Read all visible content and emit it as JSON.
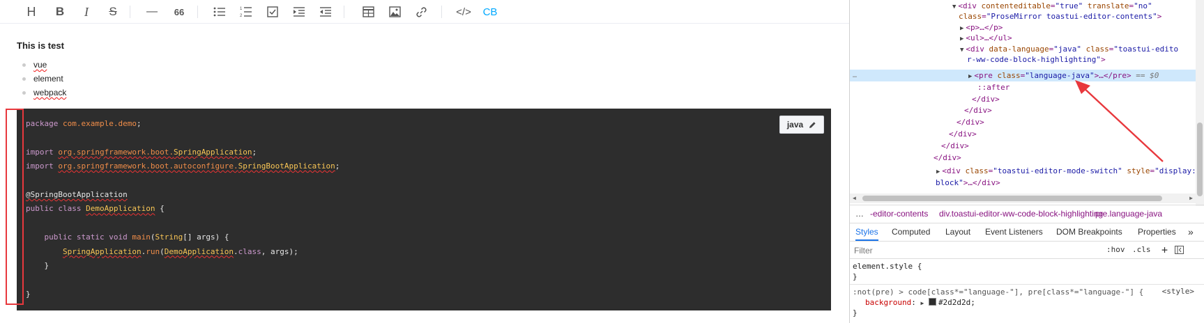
{
  "toolbar": {
    "buttons": [
      {
        "name": "heading",
        "glyph": "H"
      },
      {
        "name": "bold",
        "glyph": "B"
      },
      {
        "name": "italic",
        "glyph": "I"
      },
      {
        "name": "strike",
        "glyph": "S"
      },
      {
        "name": "hr",
        "glyph": "—"
      },
      {
        "name": "quote",
        "glyph": "66"
      },
      {
        "name": "ul"
      },
      {
        "name": "ol"
      },
      {
        "name": "task"
      },
      {
        "name": "indent"
      },
      {
        "name": "outdent"
      },
      {
        "name": "table"
      },
      {
        "name": "image"
      },
      {
        "name": "link"
      },
      {
        "name": "code",
        "glyph": "</>"
      },
      {
        "name": "codeblock",
        "glyph": "CB"
      }
    ],
    "accent_color": "#00a9ff"
  },
  "editor": {
    "heading": "This is test",
    "list": [
      "vue",
      "element",
      "webpack"
    ],
    "code_block": {
      "language_button": "java",
      "lines": {
        "l1_kw": "package",
        "l1_pkg": "com.example.demo",
        "l1_end": ";",
        "l3_kw": "import",
        "l3_pkg": "org.springframework.boot.",
        "l3_cls": "SpringApplication",
        "l3_end": ";",
        "l4_kw": "import",
        "l4_pkg": "org.springframework.boot.autoconfigure.",
        "l4_cls": "SpringBootApplication",
        "l4_end": ";",
        "l6_ann": "@SpringBootApplication",
        "l7_kw": "public class",
        "l7_cls": "DemoApplication",
        "l7_end": " {",
        "l9_kw": "public static void",
        "l9_fn": "main",
        "l9_open": "(",
        "l9_cls": "String",
        "l9_end": "[] args) {",
        "l10_cls": "SpringApplication",
        "l10_dot": ".",
        "l10_fn": "run",
        "l10_open": "(",
        "l10_cls2": "DemoApplication",
        "l10_dot2": ".",
        "l10_kw": "class",
        "l10_end": ", args);",
        "l11": "}",
        "l13": "}"
      }
    }
  },
  "devtools": {
    "dom": {
      "r1_tag": "<div ",
      "r1_a1": "contenteditable",
      "r1_v1": "\"true\"",
      "r1_a2": "translate",
      "r1_v2": "\"no\"",
      "r2_a": "class",
      "r2_v": "\"ProseMirror toastui-editor-contents\"",
      "r2_end": ">",
      "r3": "<p>…</p>",
      "r4": "<ul>…</ul>",
      "r5_tag": "<div ",
      "r5_a1": "data-language",
      "r5_v1": "\"java\"",
      "r5_a2": "class",
      "r5_v2": "\"toastui-edito",
      "r6_v": "r-ww-code-block-highlighting\"",
      "r6_end": ">",
      "r7_tag": "<pre ",
      "r7_a": "class",
      "r7_v": "\"language-java\"",
      "r7_end": ">…</pre>",
      "r7_eq": " == $0",
      "r8": "::after",
      "r9": "</div>",
      "r10": "</div>",
      "r11": "</div>",
      "r12": "</div>",
      "r13": "</div>",
      "r14": "</div>",
      "r15_tag": "<div ",
      "r15_a1": "class",
      "r15_v1": "\"toastui-editor-mode-switch\"",
      "r15_a2": "style",
      "r15_v2": "\"display:",
      "r16_v": "block\"",
      "r16_end": ">…</div>",
      "dots": "…"
    },
    "breadcrumbs": [
      "…",
      "-editor-contents",
      "div.toastui-editor-ww-code-block-highlighting",
      "pre.language-java"
    ],
    "tabs": [
      "Styles",
      "Computed",
      "Layout",
      "Event Listeners",
      "DOM Breakpoints",
      "Properties",
      "»"
    ],
    "filter": {
      "placeholder": "Filter",
      "hov": ":hov",
      "cls": ".cls",
      "plus": "+"
    },
    "styles": {
      "rule1_selector": "element.style {",
      "rule1_close": "}",
      "rule2_selector": ":not(pre) > code[class*=\"language-\"], pre[class*=\"language-\"] {",
      "rule2_source": "<style>",
      "rule2_prop": "background",
      "rule2_colon": ":",
      "rule2_value": "#2d2d2d;",
      "rule2_close": "}"
    }
  }
}
